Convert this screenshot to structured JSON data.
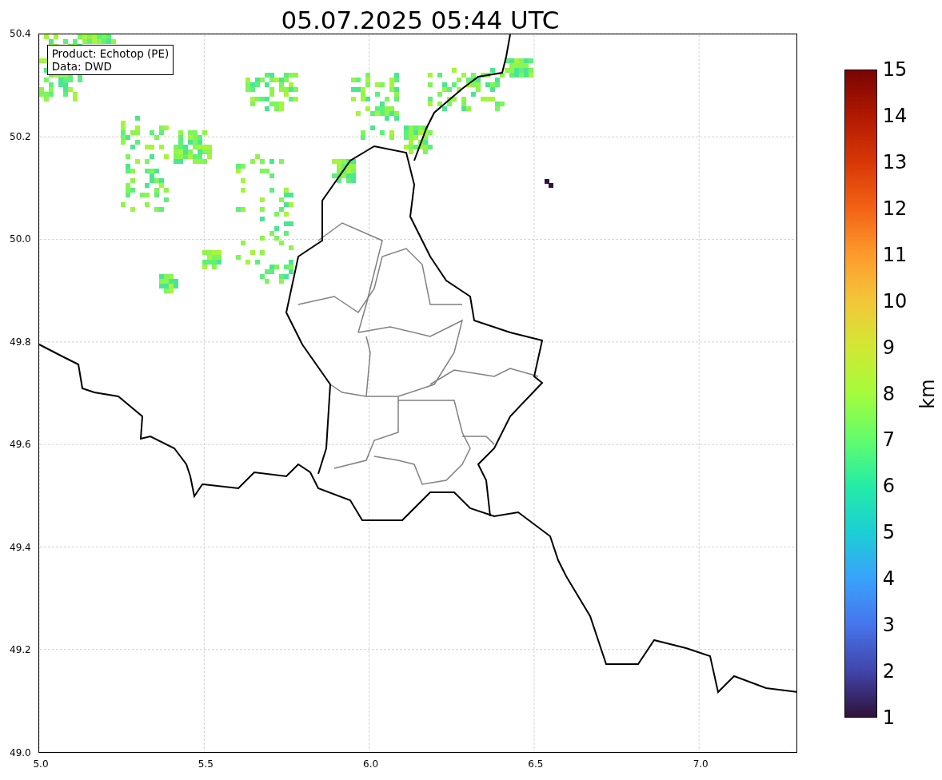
{
  "title": "05.07.2025 05:44 UTC",
  "legend": [
    "Product: Echotop (PE)",
    "Data: DWD"
  ],
  "x_ticks": [
    "5.0",
    "5.5",
    "6.0",
    "6.5",
    "7.0"
  ],
  "y_ticks": [
    "50.4",
    "50.2",
    "50.0",
    "49.8",
    "49.6",
    "49.4",
    "49.2",
    "49.0"
  ],
  "colorbar": {
    "label": "km",
    "ticks": [
      "15",
      "14",
      "13",
      "12",
      "11",
      "10",
      "9",
      "8",
      "7",
      "6",
      "5",
      "4",
      "3",
      "2",
      "1"
    ]
  }
}
